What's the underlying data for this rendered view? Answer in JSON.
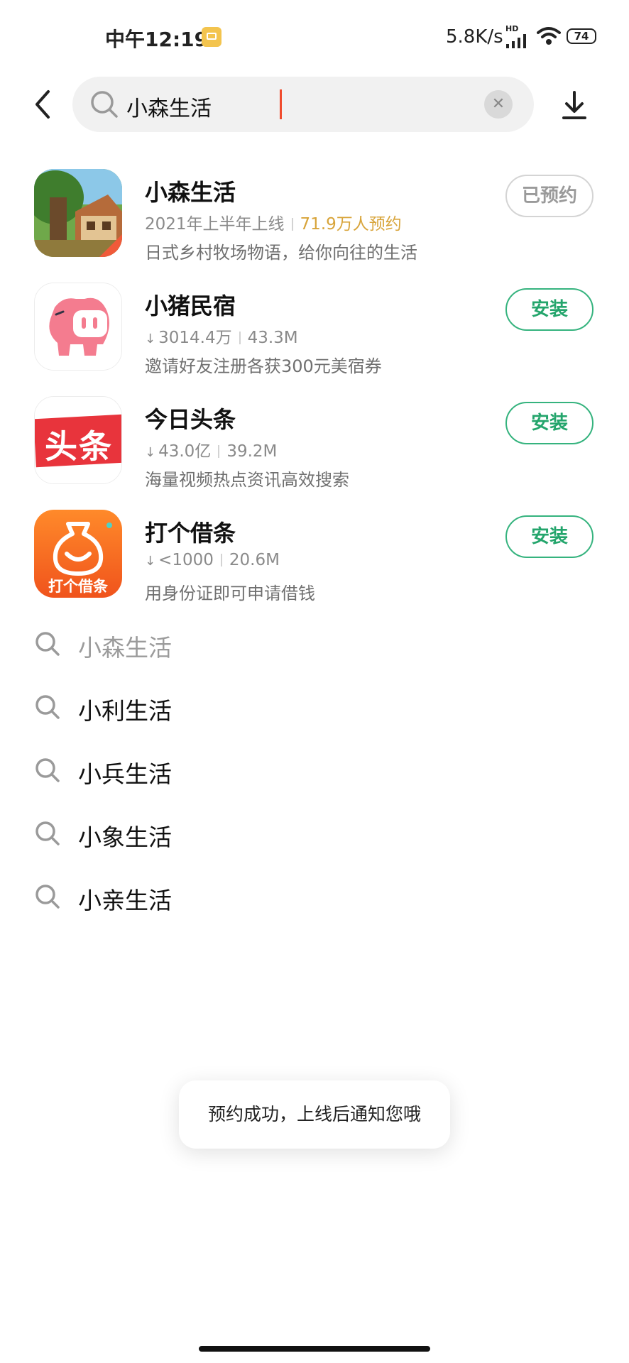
{
  "status_bar": {
    "time": "中午12:19",
    "speed": "5.8K/s",
    "hd": "HD",
    "battery": "74"
  },
  "search": {
    "value": "小森生活",
    "clear_icon": "close-icon"
  },
  "apps": [
    {
      "name": "小森生活",
      "meta_primary": "2021年上半年上线",
      "meta_secondary": "71.9万人预约",
      "desc": "日式乡村牧场物语，给你向往的生活",
      "button": "已预约"
    },
    {
      "name": "小猪民宿",
      "downloads": "3014.4万",
      "size": "43.3M",
      "desc": "邀请好友注册各获300元美宿券",
      "button": "安装"
    },
    {
      "name": "今日头条",
      "icon_text": "头条",
      "downloads": "43.0亿",
      "size": "39.2M",
      "desc": "海量视频热点资讯高效搜索",
      "button": "安装"
    },
    {
      "name": "打个借条",
      "icon_text": "打个借条",
      "downloads": "<1000",
      "size": "20.6M",
      "desc": "用身份证即可申请借钱",
      "button": "安装"
    }
  ],
  "suggestions": [
    "小森生活",
    "小利生活",
    "小兵生活",
    "小象生活",
    "小亲生活"
  ],
  "toast": "预约成功，上线后通知您哦",
  "colors": {
    "install_green": "#24a56c",
    "highlight_gold": "#d8a43a",
    "caret": "#f04b2d"
  }
}
